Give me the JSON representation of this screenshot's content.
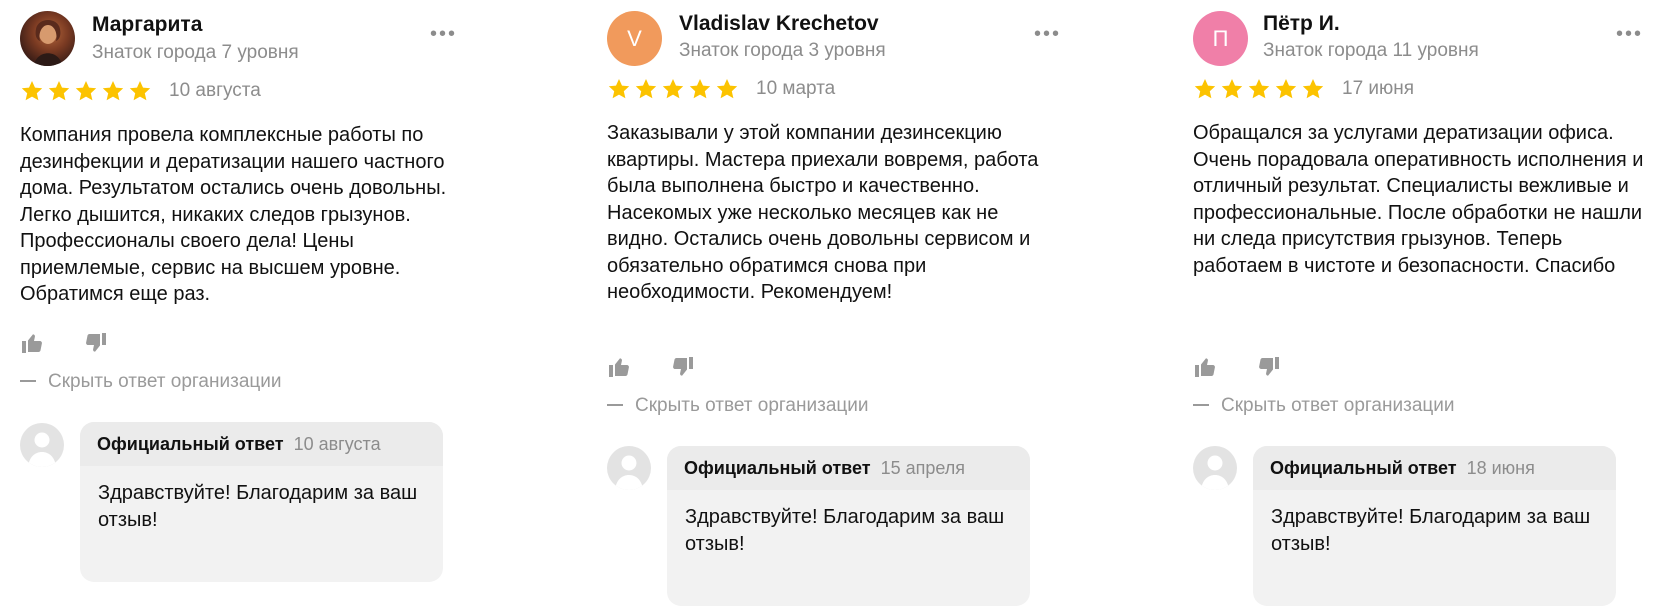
{
  "reviews": [
    {
      "author": "Маргарита",
      "avatar_letter": "",
      "level": "Знаток города 7 уровня",
      "more": "•••",
      "rating": 5,
      "date": "10 августа",
      "text": "Компания провела комплексные работы по дезинфекции и дератизации нашего частного дома. Результатом остались очень довольны. Легко дышится, никаких следов грызунов. Профессионалы своего дела! Цены приемлемые, сервис на высшем уровне. Обратимся еще раз.",
      "hide_reply": "Скрыть ответ организации",
      "answer_title": "Официальный ответ",
      "answer_date": "10 августа",
      "answer_text": "Здравствуйте! Благодарим за ваш отзыв!"
    },
    {
      "author": "Vladislav Krechetov",
      "avatar_letter": "V",
      "avatar_color": "#f19a5c",
      "level": "Знаток города 3 уровня",
      "more": "•••",
      "rating": 5,
      "date": "10 марта",
      "text": "Заказывали у этой компании дезинсекцию квартиры. Мастера приехали вовремя, работа была выполнена быстро и качественно. Насекомых уже несколько месяцев как не видно. Остались очень довольны сервисом и обязательно обратимся снова при необходимости. Рекомендуем!",
      "hide_reply": "Скрыть ответ организации",
      "answer_title": "Официальный ответ",
      "answer_date": "15 апреля",
      "answer_text": "Здравствуйте! Благодарим за ваш отзыв!"
    },
    {
      "author": "Пётр И.",
      "avatar_letter": "П",
      "avatar_color": "#f07fa8",
      "level": "Знаток города 11 уровня",
      "more": "•••",
      "rating": 5,
      "date": "17 июня",
      "text": "Обращался за услугами дератизации офиса. Очень порадовала оперативность исполнения и отличный результат. Специалисты вежливые и профессиональные. После обработки не нашли ни следа присутствия грызунов. Теперь работаем в чистоте и безопасности. Спасибо",
      "hide_reply": "Скрыть ответ организации",
      "answer_title": "Официальный ответ",
      "answer_date": "18 июня",
      "answer_text": "Здравствуйте! Благодарим за ваш отзыв!"
    }
  ],
  "colors": {
    "star": "#fcc300",
    "muted": "#8c8c8c",
    "answer_bg": "#f2f2f2"
  },
  "icons": [
    "star-icon",
    "thumbs-up-icon",
    "thumbs-down-icon",
    "more-dots-icon",
    "user-silhouette-icon"
  ]
}
